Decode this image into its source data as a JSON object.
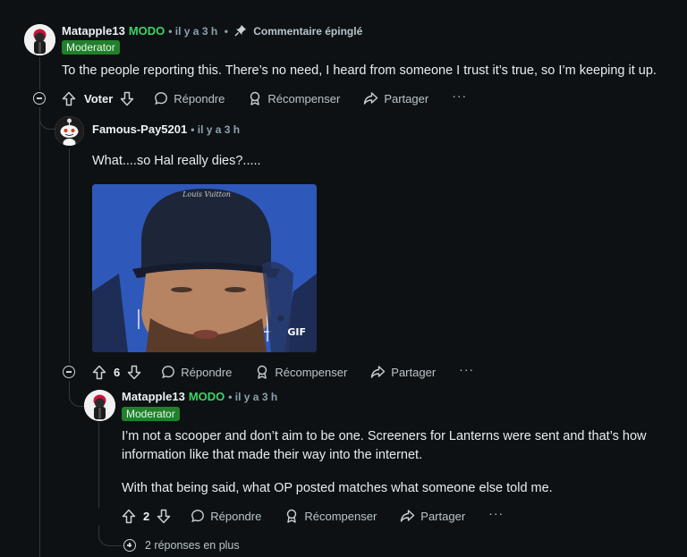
{
  "comment1": {
    "username": "Matapple13",
    "role": "MODO",
    "time": "• il y a 3 h",
    "separator": "•",
    "pinned_label": "Commentaire épinglé",
    "badge": "Moderator",
    "body": "To the people reporting this. There’s no need, I heard from someone I trust it’s true, so I’m keeping it up.",
    "actions": {
      "vote_label": "Voter",
      "reply": "Répondre",
      "award": "Récompenser",
      "share": "Partager",
      "more": "···"
    }
  },
  "comment2": {
    "username": "Famous-Pay5201",
    "time": "• il y a 3 h",
    "body": "What....so Hal really dies?.....",
    "gif_label": "GIF",
    "gif_logo": "Louis Vuitton",
    "votes": "6",
    "actions": {
      "reply": "Répondre",
      "award": "Récompenser",
      "share": "Partager",
      "more": "···"
    }
  },
  "comment3": {
    "username": "Matapple13",
    "role": "MODO",
    "time": "• il y a 3 h",
    "badge": "Moderator",
    "body1": "I’m not a scooper and don’t aim to be one. Screeners for Lanterns were sent and that’s how information like that made their way into the internet.",
    "body2": "With that being said, what OP posted matches what someone else told me.",
    "votes": "2",
    "actions": {
      "reply": "Répondre",
      "award": "Récompenser",
      "share": "Partager",
      "more": "···"
    }
  },
  "more_replies": "2 réponses en plus",
  "colors": {
    "background": "#0e1113",
    "moderator_green": "#3dd468",
    "badge_green": "#22802c",
    "gif_blue": "#2e56b8"
  }
}
